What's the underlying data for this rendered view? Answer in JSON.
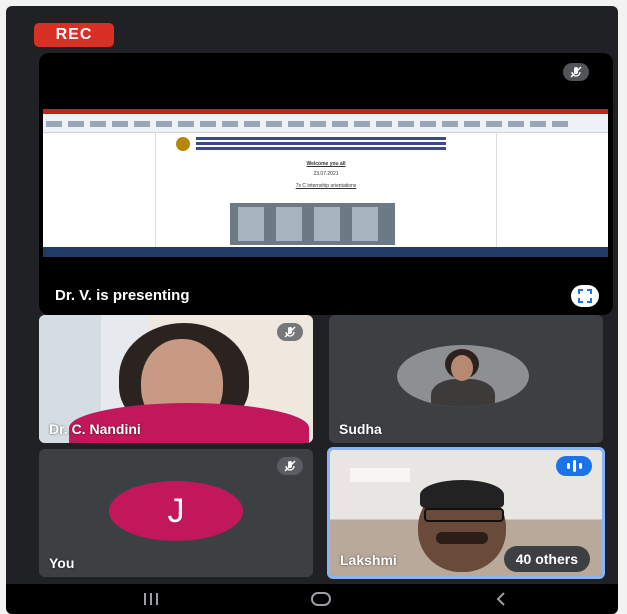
{
  "recording": {
    "label": "REC",
    "color": "#d93025"
  },
  "presentation": {
    "label": "Dr. V. is presenting",
    "slide": {
      "line1": "Welcome you all",
      "line2": "23.07.2021",
      "line3": "7x C internship orientations"
    },
    "icons": {
      "mute": "mic-off-icon",
      "fullscreen": "fullscreen-icon"
    }
  },
  "participants": [
    {
      "name": "Dr. C. Nandini",
      "muted": true
    },
    {
      "name": "Sudha",
      "muted": false
    },
    {
      "name": "You",
      "initial": "J",
      "muted": true,
      "avatar_color": "#c2185b"
    },
    {
      "name": "Lakshmi",
      "speaking": true,
      "highlight_color": "#8ab4f8"
    }
  ],
  "overflow": {
    "label": "40 others"
  },
  "navigation": {
    "recents": "recents-icon",
    "home": "home-icon",
    "back": "back-icon"
  }
}
